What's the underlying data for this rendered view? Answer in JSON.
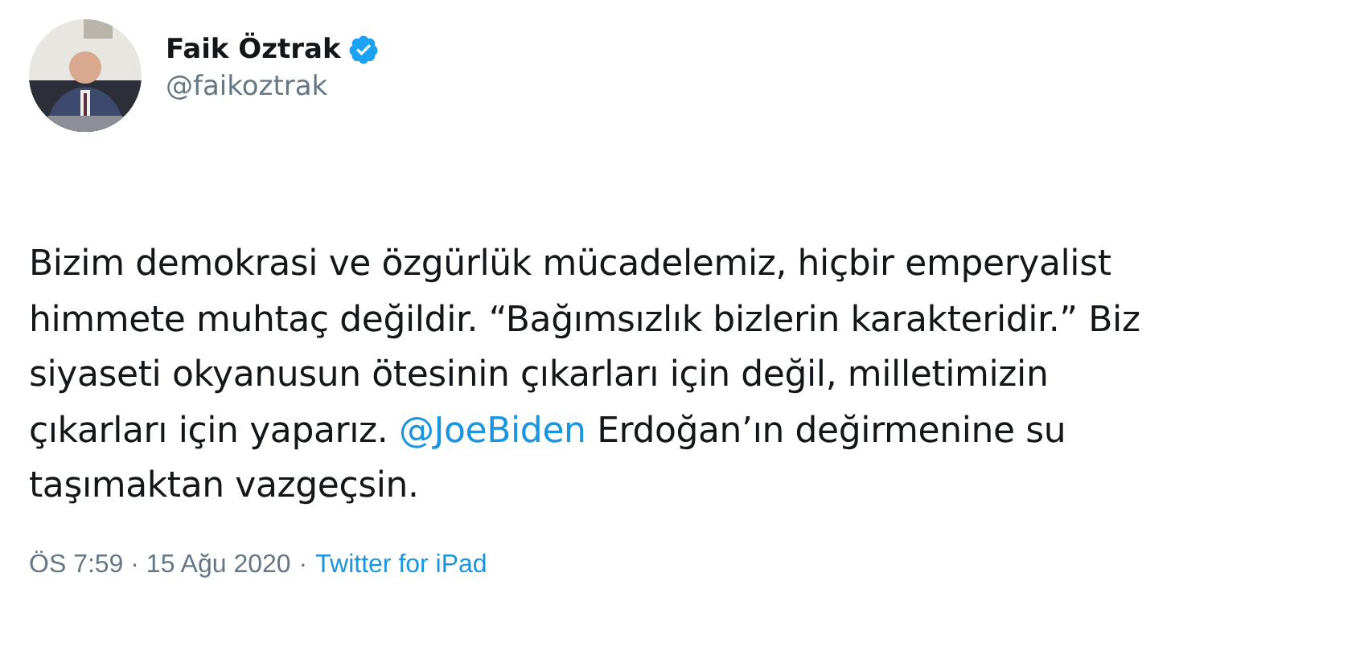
{
  "author": {
    "name": "Faik Öztrak",
    "verified": true,
    "handle": "@faikoztrak"
  },
  "tweet": {
    "text_before": "Bizim demokrasi ve özgürlük mücadelemiz, hiçbir emperyalist  himmete muhtaç değildir. “Bağımsızlık bizlerin karakteridir.” Biz siyaseti okyanusun ötesinin çıkarları için değil, milletimizin çıkarları için yaparız. ",
    "mention": "@JoeBiden",
    "text_after": " Erdoğan’ın değirmenine su taşımaktan vazgeçsin."
  },
  "footer": {
    "timestamp": "ÖS 7:59 · 15 Ağu 2020",
    "separator": "·",
    "source": "Twitter for iPad"
  }
}
